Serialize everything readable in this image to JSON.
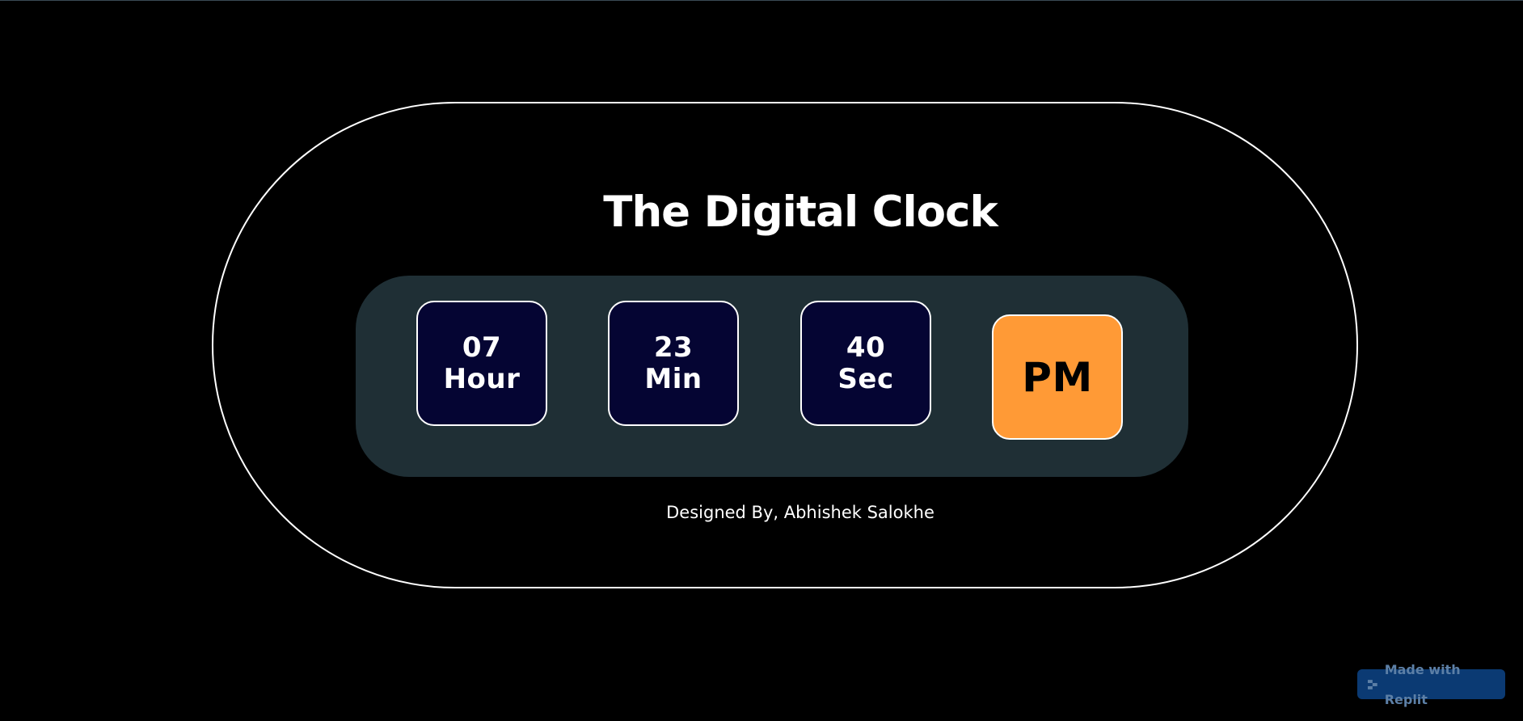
{
  "page": {
    "title": "The Digital Clock",
    "credit": "Designed By, Abhishek Salokhe"
  },
  "clock": {
    "hour": {
      "value": "07",
      "unit": "Hour"
    },
    "minute": {
      "value": "23",
      "unit": "Min"
    },
    "second": {
      "value": "40",
      "unit": "Sec"
    },
    "ampm": "PM"
  },
  "badge": {
    "label": "Made with Replit",
    "icon": "replit-icon"
  },
  "colors": {
    "background": "#000000",
    "panel": "#1f2f35",
    "tile": "#050533",
    "ampm_tile": "#ff9a36",
    "badge": "#0b3a73"
  }
}
